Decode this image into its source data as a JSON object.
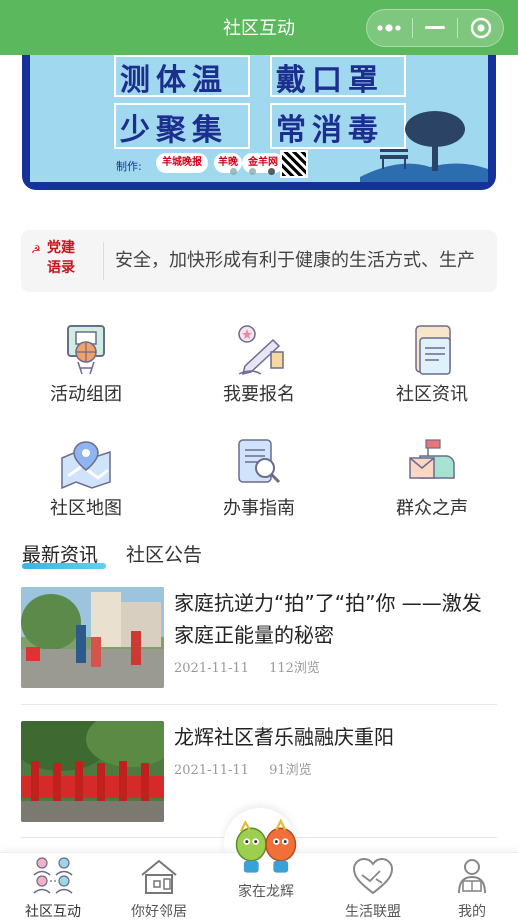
{
  "header": {
    "title": "社区互动",
    "more_icon": "more-dots-icon",
    "minimize_icon": "minimize-icon",
    "close_icon": "target-close-icon"
  },
  "banner": {
    "line1_left": "测体温",
    "line1_right": "戴口罩",
    "line2_left": "少聚集",
    "line2_right": "常消毒",
    "maker_label": "制作:",
    "logo_a": "羊城晚报",
    "logo_b": "羊晚",
    "logo_c": "金羊网"
  },
  "notice": {
    "tag_line1": "党建",
    "tag_line2": "语录",
    "text": "安全，加快形成有利于健康的生活方式、生产"
  },
  "grid": [
    {
      "label": "活动组团",
      "icon": "basketball-board-icon"
    },
    {
      "label": "我要报名",
      "icon": "signup-pen-icon"
    },
    {
      "label": "社区资讯",
      "icon": "newspaper-scroll-icon"
    },
    {
      "label": "社区地图",
      "icon": "map-pin-icon"
    },
    {
      "label": "办事指南",
      "icon": "guide-book-search-icon"
    },
    {
      "label": "群众之声",
      "icon": "mailbox-icon"
    }
  ],
  "tabs": {
    "active": "最新资讯",
    "inactive": "社区公告"
  },
  "news": [
    {
      "title": "家庭抗逆力“拍”了“拍”你 ——激发家庭正能量的秘密",
      "date": "2021-11-11",
      "views": "112浏览"
    },
    {
      "title": "龙辉社区耆乐融融庆重阳",
      "date": "2021-11-11",
      "views": "91浏览"
    }
  ],
  "bottom_nav": [
    {
      "label": "社区互动",
      "icon": "community-people-icon"
    },
    {
      "label": "你好邻居",
      "icon": "neighbor-house-icon"
    },
    {
      "label": "家在龙辉",
      "icon": "dragon-mascot-icon"
    },
    {
      "label": "生活联盟",
      "icon": "heart-handshake-icon"
    },
    {
      "label": "我的",
      "icon": "profile-reader-icon"
    }
  ],
  "colors": {
    "header_green": "#5cb85c",
    "banner_blue": "#15319a",
    "party_red": "#c8161d",
    "tab_accent": "#37b4e8"
  }
}
